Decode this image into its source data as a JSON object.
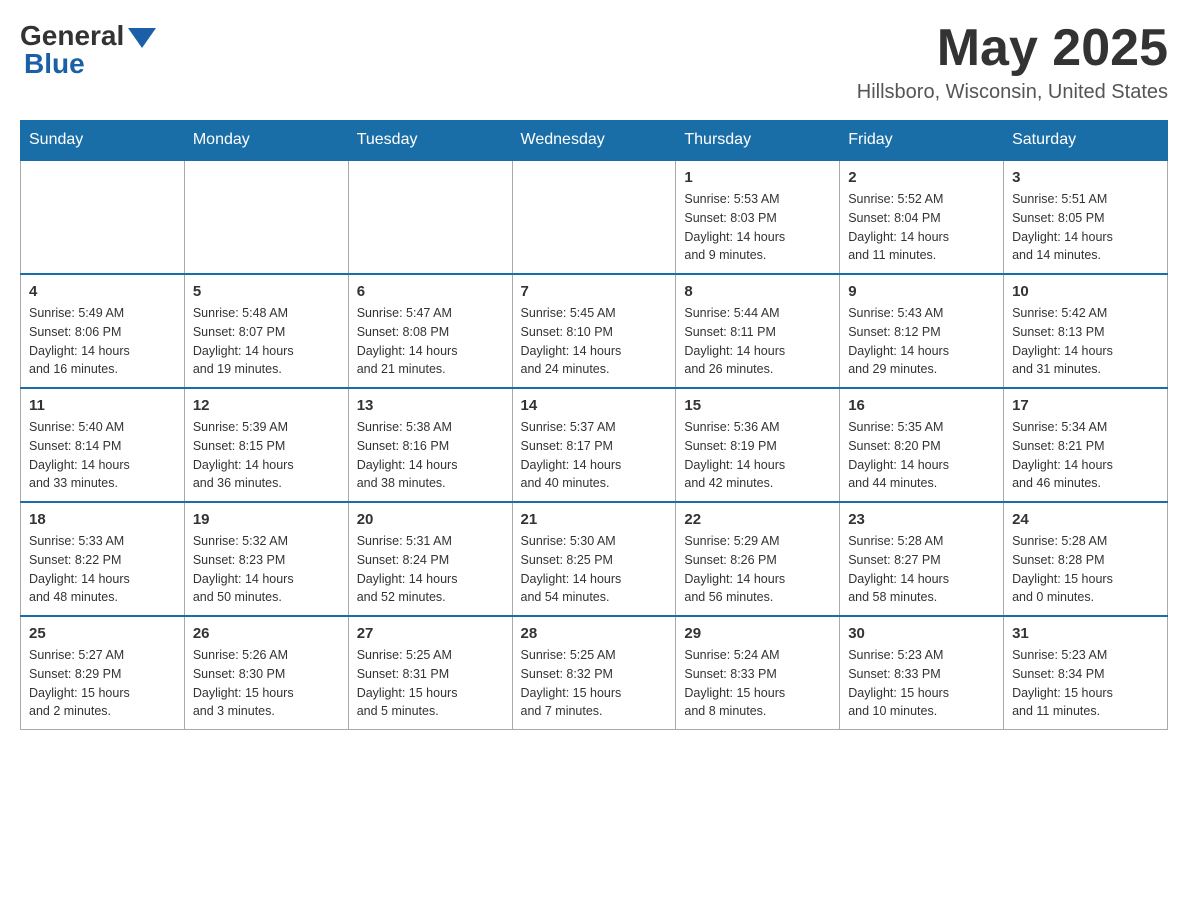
{
  "logo": {
    "general": "General",
    "blue": "Blue"
  },
  "title": {
    "month": "May 2025",
    "location": "Hillsboro, Wisconsin, United States"
  },
  "weekdays": [
    "Sunday",
    "Monday",
    "Tuesday",
    "Wednesday",
    "Thursday",
    "Friday",
    "Saturday"
  ],
  "weeks": [
    [
      {
        "day": "",
        "info": ""
      },
      {
        "day": "",
        "info": ""
      },
      {
        "day": "",
        "info": ""
      },
      {
        "day": "",
        "info": ""
      },
      {
        "day": "1",
        "info": "Sunrise: 5:53 AM\nSunset: 8:03 PM\nDaylight: 14 hours\nand 9 minutes."
      },
      {
        "day": "2",
        "info": "Sunrise: 5:52 AM\nSunset: 8:04 PM\nDaylight: 14 hours\nand 11 minutes."
      },
      {
        "day": "3",
        "info": "Sunrise: 5:51 AM\nSunset: 8:05 PM\nDaylight: 14 hours\nand 14 minutes."
      }
    ],
    [
      {
        "day": "4",
        "info": "Sunrise: 5:49 AM\nSunset: 8:06 PM\nDaylight: 14 hours\nand 16 minutes."
      },
      {
        "day": "5",
        "info": "Sunrise: 5:48 AM\nSunset: 8:07 PM\nDaylight: 14 hours\nand 19 minutes."
      },
      {
        "day": "6",
        "info": "Sunrise: 5:47 AM\nSunset: 8:08 PM\nDaylight: 14 hours\nand 21 minutes."
      },
      {
        "day": "7",
        "info": "Sunrise: 5:45 AM\nSunset: 8:10 PM\nDaylight: 14 hours\nand 24 minutes."
      },
      {
        "day": "8",
        "info": "Sunrise: 5:44 AM\nSunset: 8:11 PM\nDaylight: 14 hours\nand 26 minutes."
      },
      {
        "day": "9",
        "info": "Sunrise: 5:43 AM\nSunset: 8:12 PM\nDaylight: 14 hours\nand 29 minutes."
      },
      {
        "day": "10",
        "info": "Sunrise: 5:42 AM\nSunset: 8:13 PM\nDaylight: 14 hours\nand 31 minutes."
      }
    ],
    [
      {
        "day": "11",
        "info": "Sunrise: 5:40 AM\nSunset: 8:14 PM\nDaylight: 14 hours\nand 33 minutes."
      },
      {
        "day": "12",
        "info": "Sunrise: 5:39 AM\nSunset: 8:15 PM\nDaylight: 14 hours\nand 36 minutes."
      },
      {
        "day": "13",
        "info": "Sunrise: 5:38 AM\nSunset: 8:16 PM\nDaylight: 14 hours\nand 38 minutes."
      },
      {
        "day": "14",
        "info": "Sunrise: 5:37 AM\nSunset: 8:17 PM\nDaylight: 14 hours\nand 40 minutes."
      },
      {
        "day": "15",
        "info": "Sunrise: 5:36 AM\nSunset: 8:19 PM\nDaylight: 14 hours\nand 42 minutes."
      },
      {
        "day": "16",
        "info": "Sunrise: 5:35 AM\nSunset: 8:20 PM\nDaylight: 14 hours\nand 44 minutes."
      },
      {
        "day": "17",
        "info": "Sunrise: 5:34 AM\nSunset: 8:21 PM\nDaylight: 14 hours\nand 46 minutes."
      }
    ],
    [
      {
        "day": "18",
        "info": "Sunrise: 5:33 AM\nSunset: 8:22 PM\nDaylight: 14 hours\nand 48 minutes."
      },
      {
        "day": "19",
        "info": "Sunrise: 5:32 AM\nSunset: 8:23 PM\nDaylight: 14 hours\nand 50 minutes."
      },
      {
        "day": "20",
        "info": "Sunrise: 5:31 AM\nSunset: 8:24 PM\nDaylight: 14 hours\nand 52 minutes."
      },
      {
        "day": "21",
        "info": "Sunrise: 5:30 AM\nSunset: 8:25 PM\nDaylight: 14 hours\nand 54 minutes."
      },
      {
        "day": "22",
        "info": "Sunrise: 5:29 AM\nSunset: 8:26 PM\nDaylight: 14 hours\nand 56 minutes."
      },
      {
        "day": "23",
        "info": "Sunrise: 5:28 AM\nSunset: 8:27 PM\nDaylight: 14 hours\nand 58 minutes."
      },
      {
        "day": "24",
        "info": "Sunrise: 5:28 AM\nSunset: 8:28 PM\nDaylight: 15 hours\nand 0 minutes."
      }
    ],
    [
      {
        "day": "25",
        "info": "Sunrise: 5:27 AM\nSunset: 8:29 PM\nDaylight: 15 hours\nand 2 minutes."
      },
      {
        "day": "26",
        "info": "Sunrise: 5:26 AM\nSunset: 8:30 PM\nDaylight: 15 hours\nand 3 minutes."
      },
      {
        "day": "27",
        "info": "Sunrise: 5:25 AM\nSunset: 8:31 PM\nDaylight: 15 hours\nand 5 minutes."
      },
      {
        "day": "28",
        "info": "Sunrise: 5:25 AM\nSunset: 8:32 PM\nDaylight: 15 hours\nand 7 minutes."
      },
      {
        "day": "29",
        "info": "Sunrise: 5:24 AM\nSunset: 8:33 PM\nDaylight: 15 hours\nand 8 minutes."
      },
      {
        "day": "30",
        "info": "Sunrise: 5:23 AM\nSunset: 8:33 PM\nDaylight: 15 hours\nand 10 minutes."
      },
      {
        "day": "31",
        "info": "Sunrise: 5:23 AM\nSunset: 8:34 PM\nDaylight: 15 hours\nand 11 minutes."
      }
    ]
  ]
}
